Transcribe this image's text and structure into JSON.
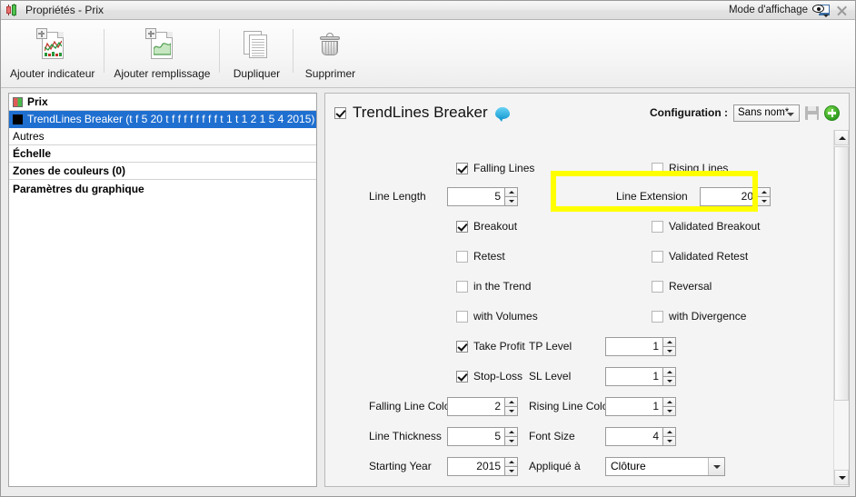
{
  "window": {
    "title": "Propriétés - Prix",
    "app_icon": "candlestick-icon",
    "mode_label": "Mode d'affichage",
    "close_label": "×"
  },
  "toolbar": {
    "buttons": [
      {
        "label": "Ajouter indicateur",
        "icon": "add-indicator-icon"
      },
      {
        "label": "Ajouter remplissage",
        "icon": "add-fill-icon"
      },
      {
        "label": "Dupliquer",
        "icon": "duplicate-icon"
      },
      {
        "label": "Supprimer",
        "icon": "delete-icon"
      }
    ]
  },
  "sidebar": {
    "items": [
      {
        "label": "Prix",
        "bold": true,
        "selected": false,
        "swatch": "price"
      },
      {
        "label": "TrendLines Breaker (t f 5 20 t f f f f f f f f t 1 t 1 2 1 5 4 2015)",
        "bold": false,
        "selected": true,
        "swatch": "black"
      },
      {
        "label": "Autres",
        "bold": false,
        "selected": false,
        "swatch": null
      },
      {
        "label": "Échelle",
        "bold": true,
        "selected": false,
        "swatch": null
      },
      {
        "label": "Zones de couleurs (0)",
        "bold": true,
        "selected": false,
        "swatch": null
      },
      {
        "label": "Paramètres du graphique",
        "bold": true,
        "selected": false,
        "swatch": null
      }
    ]
  },
  "panel": {
    "enabled_label": "TrendLines Breaker",
    "enabled_checked": true,
    "info_icon": "speech-bubble-icon",
    "config_label": "Configuration :",
    "config_value": "Sans nom*",
    "save_icon": "save-icon",
    "add_icon": "add-config-icon",
    "checkboxes": {
      "falling_lines": {
        "label": "Falling Lines",
        "checked": true
      },
      "rising_lines": {
        "label": "Rising Lines",
        "checked": false
      },
      "breakout": {
        "label": "Breakout",
        "checked": true
      },
      "validated_breakout": {
        "label": "Validated Breakout",
        "checked": false
      },
      "retest": {
        "label": "Retest",
        "checked": false
      },
      "validated_retest": {
        "label": "Validated Retest",
        "checked": false
      },
      "in_the_trend": {
        "label": "in the Trend",
        "checked": false
      },
      "reversal": {
        "label": "Reversal",
        "checked": false
      },
      "with_volumes": {
        "label": "with Volumes",
        "checked": false
      },
      "with_divergence": {
        "label": "with Divergence",
        "checked": false
      },
      "take_profit": {
        "label": "Take Profit",
        "checked": true
      },
      "stop_loss": {
        "label": "Stop-Loss",
        "checked": true
      }
    },
    "fields": {
      "line_length": {
        "label": "Line Length",
        "value": "5"
      },
      "line_extension": {
        "label": "Line Extension",
        "value": "20"
      },
      "tp_level": {
        "label": "TP Level",
        "value": "1"
      },
      "sl_level": {
        "label": "SL Level",
        "value": "1"
      },
      "falling_line_color": {
        "label": "Falling Line Color",
        "value": "2"
      },
      "rising_line_color": {
        "label": "Rising Line Color",
        "value": "1"
      },
      "line_thickness": {
        "label": "Line Thickness",
        "value": "5"
      },
      "font_size": {
        "label": "Font Size",
        "value": "4"
      },
      "starting_year": {
        "label": "Starting Year",
        "value": "2015"
      },
      "applied_to": {
        "label": "Appliqué à",
        "value": "Clôture"
      }
    },
    "highlight_color": "#ffff00"
  }
}
